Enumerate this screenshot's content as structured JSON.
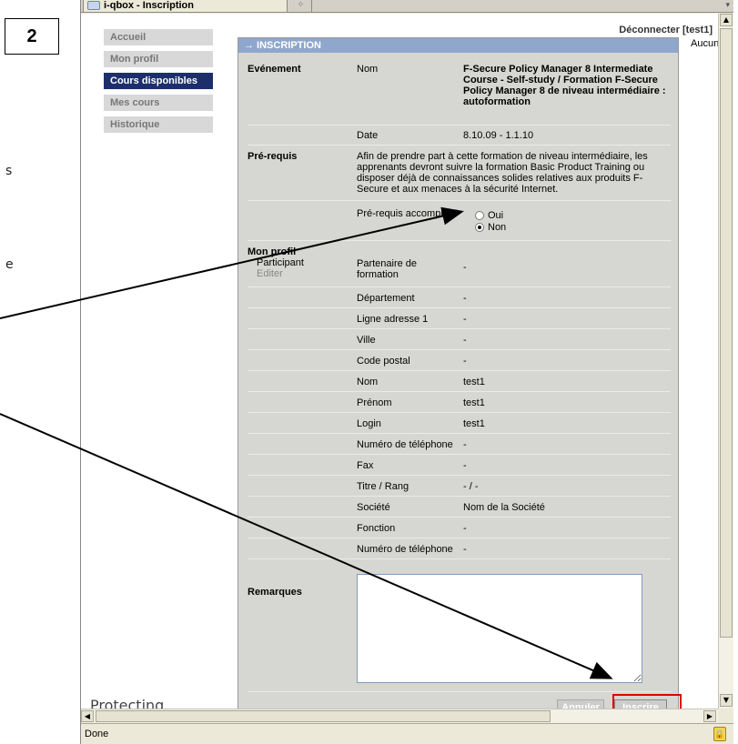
{
  "step": "2",
  "side_text": {
    "a": "s",
    "b": "e"
  },
  "browser": {
    "tab_title": "i-qbox - Inscription",
    "status": "Done"
  },
  "header": {
    "disconnect": "Déconnecter [test1]",
    "aucun": "Aucun"
  },
  "sidebar": {
    "items": [
      {
        "label": "Accueil",
        "active": false
      },
      {
        "label": "Mon profil",
        "active": false
      },
      {
        "label": "Cours disponibles",
        "active": true
      },
      {
        "label": "Mes cours",
        "active": false
      },
      {
        "label": "Historique",
        "active": false
      }
    ],
    "brand": "Protecting"
  },
  "panel": {
    "title": "→ INSCRIPTION",
    "event_label": "Evénement",
    "name_label": "Nom",
    "event_name": "F-Secure Policy Manager 8 Intermediate Course - Self-study / Formation F-Secure Policy Manager 8 de niveau intermédiaire : autoformation",
    "date_label": "Date",
    "date_value": "8.10.09 - 1.1.10",
    "prereq_label": "Pré-requis",
    "prereq_text": "Afin de prendre part à cette formation de niveau intermédiaire, les apprenants devront suivre la formation Basic Product Training ou disposer déjà de connaissances solides relatives aux produits F-Secure et aux menaces à la sécurité Internet.",
    "prereq_done_label": "Pré-requis accomplis ?",
    "oui": "Oui",
    "non": "Non",
    "profile_label": "Mon profil",
    "participant": "Participant",
    "edit": "Editer",
    "profile_fields": [
      {
        "label": "Partenaire de formation",
        "value": "-"
      },
      {
        "label": "Département",
        "value": "-"
      },
      {
        "label": "Ligne adresse 1",
        "value": "-"
      },
      {
        "label": "Ville",
        "value": "-"
      },
      {
        "label": "Code postal",
        "value": "-"
      },
      {
        "label": "Nom",
        "value": "test1"
      },
      {
        "label": "Prénom",
        "value": "test1"
      },
      {
        "label": "Login",
        "value": "test1"
      },
      {
        "label": "Numéro de téléphone",
        "value": "-"
      },
      {
        "label": "Fax",
        "value": "-"
      },
      {
        "label": "Titre / Rang",
        "value": "- / -"
      },
      {
        "label": "Société",
        "value": "Nom de la Société"
      },
      {
        "label": "Fonction",
        "value": "-"
      },
      {
        "label": "Numéro de téléphone",
        "value": "-"
      }
    ],
    "remarks_label": "Remarques",
    "cancel": "Annuler",
    "submit": "Inscrire"
  }
}
